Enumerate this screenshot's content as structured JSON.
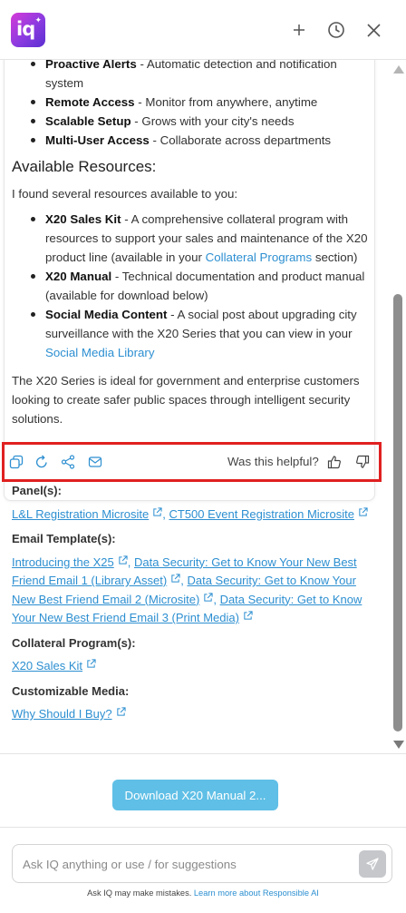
{
  "header": {
    "logo_text": "iq",
    "icons": [
      "plus-icon",
      "history-clock-icon",
      "close-icon"
    ]
  },
  "message": {
    "features": [
      {
        "title": "Proactive Alerts",
        "desc": " - Automatic detection and notification system"
      },
      {
        "title": "Remote Access",
        "desc": " - Monitor from anywhere, anytime"
      },
      {
        "title": "Scalable Setup",
        "desc": " - Grows with your city's needs"
      },
      {
        "title": "Multi-User Access",
        "desc": " - Collaborate across departments"
      }
    ],
    "resources_heading": "Available Resources:",
    "resources_intro": "I found several resources available to you:",
    "resources": [
      {
        "title": "X20 Sales Kit",
        "desc_before": " - A comprehensive collateral program with resources to support your sales and maintenance of the X20 product line (available in your ",
        "link": "Collateral Programs",
        "desc_after": " section)"
      },
      {
        "title": "X20 Manual",
        "desc_before": " - Technical documentation and product manual (available for download below)",
        "link": "",
        "desc_after": ""
      },
      {
        "title": "Social Media Content",
        "desc_before": " - A social post about upgrading city surveillance with the X20 Series that you can view in your ",
        "link": "Social Media Library",
        "desc_after": ""
      }
    ],
    "closing": "The X20 Series is ideal for government and enterprise customers looking to create safer public spaces through intelligent security solutions."
  },
  "feedback": {
    "question": "Was this helpful?",
    "icons": [
      "copy-icon",
      "regenerate-icon",
      "share-icon",
      "email-icon",
      "thumbs-up-icon",
      "thumbs-down-icon"
    ]
  },
  "references": {
    "panels_title": "Panel(s):",
    "panels": [
      "L&L Registration Microsite",
      "CT500 Event Registration Microsite"
    ],
    "email_title": "Email Template(s):",
    "emails": [
      "Introducing the X25",
      "Data Security: Get to Know Your New Best Friend Email 1 (Library Asset)",
      "Data Security: Get to Know Your New Best Friend Email 2 (Microsite)",
      "Data Security: Get to Know Your New Best Friend Email 3 (Print Media)"
    ],
    "collateral_title": "Collateral Program(s):",
    "collateral": [
      "X20 Sales Kit"
    ],
    "media_title": "Customizable Media:",
    "media": [
      "Why Should I Buy?"
    ]
  },
  "download": {
    "label": "Download X20 Manual 2..."
  },
  "input": {
    "placeholder": "Ask IQ anything or use / for suggestions",
    "value": ""
  },
  "disclaimer": {
    "text": "Ask IQ may make mistakes. ",
    "link": "Learn more about Responsible AI"
  },
  "colors": {
    "accent_link": "#2d8fd1",
    "download_button": "#5fbfe6",
    "highlight_border": "#e02020",
    "logo_gradient_start": "#d63ad8",
    "logo_gradient_end": "#5a2fd0"
  }
}
